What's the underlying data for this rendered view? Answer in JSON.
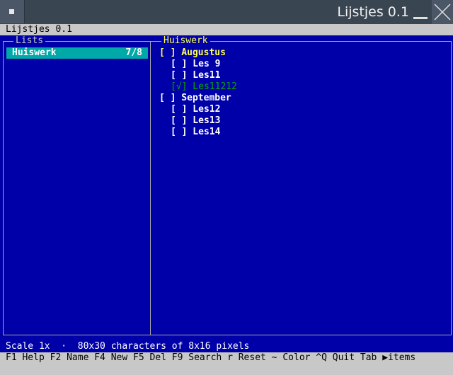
{
  "window": {
    "title": "Lijstjes 0.1"
  },
  "app": {
    "header": "Lijstjes 0.1"
  },
  "lists_panel": {
    "title": "Lists",
    "items": [
      {
        "name": "Huiswerk",
        "count": "7/8",
        "selected": true
      }
    ]
  },
  "items_panel": {
    "title": "Huiswerk",
    "items": [
      {
        "text": "[ ] Augustus"
      },
      {
        "text": "[ ] Les 9"
      },
      {
        "text": "[ ] Les11"
      },
      {
        "text": "[√] Les11212"
      },
      {
        "text": "[ ] September"
      },
      {
        "text": "[ ] Les12"
      },
      {
        "text": "[ ] Les13"
      },
      {
        "text": "[ ] Les14"
      }
    ]
  },
  "status": {
    "text": "Scale 1x  ·  80x30 characters of 8x16 pixels"
  },
  "keys": {
    "text": "F1 Help F2 Name F4 New F5 Del F9 Search r Reset ~ Color ^Q Quit Tab ▶items"
  },
  "colors": {
    "background": "#0000a8",
    "selection": "#00a8a8",
    "heading": "#ffff55",
    "done": "#00a800"
  },
  "icons": [
    "window-menu-icon",
    "minimize-icon",
    "close-icon"
  ]
}
